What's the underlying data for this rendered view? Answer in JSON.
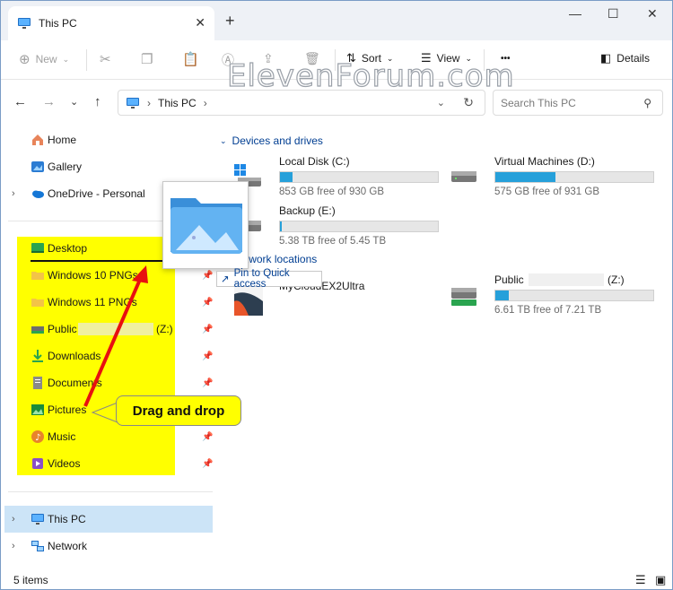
{
  "window": {
    "tab_title": "This PC",
    "new_tab": "+",
    "minimize": "—",
    "maximize": "☐",
    "close": "✕"
  },
  "toolbar": {
    "new_label": "New",
    "sort_label": "Sort",
    "view_label": "View",
    "more_label": "•••",
    "details_label": "Details"
  },
  "watermark": "ElevenForum.com",
  "address": {
    "crumb": "This PC",
    "search_placeholder": "Search This PC"
  },
  "sidebar": {
    "home": "Home",
    "gallery": "Gallery",
    "onedrive": "OneDrive - Personal",
    "pinned": [
      {
        "label": "Desktop"
      },
      {
        "label": "Windows 10 PNGs"
      },
      {
        "label": "Windows 11 PNGs"
      },
      {
        "label": "Public",
        "suffix": "(Z:)"
      },
      {
        "label": "Downloads"
      },
      {
        "label": "Documents"
      },
      {
        "label": "Pictures"
      },
      {
        "label": "Music"
      },
      {
        "label": "Videos"
      }
    ],
    "this_pc": "This PC",
    "network": "Network"
  },
  "main": {
    "devices_header": "Devices and drives",
    "network_header": "Network locations",
    "drives": [
      {
        "name": "Local Disk (C:)",
        "free": "853 GB free of 930 GB",
        "used_fraction": 0.08
      },
      {
        "name": "Virtual Machines (D:)",
        "free": "575 GB free of 931 GB",
        "used_fraction": 0.38
      },
      {
        "name": "Backup (E:)",
        "free": "5.38 TB free of 5.45 TB",
        "used_fraction": 0.013
      }
    ],
    "network_locations": [
      {
        "name": "MyCloudEX2Ultra"
      },
      {
        "name": "Public",
        "suffix": "(Z:)",
        "free": "6.61 TB free of 7.21 TB",
        "used_fraction": 0.083
      }
    ]
  },
  "drag": {
    "tooltip": "Pin to Quick access",
    "callout": "Drag and drop"
  },
  "status": {
    "items": "5 items"
  },
  "colors": {
    "highlight": "#ffff00",
    "accent": "#26a0da",
    "arrow": "#e81010"
  }
}
